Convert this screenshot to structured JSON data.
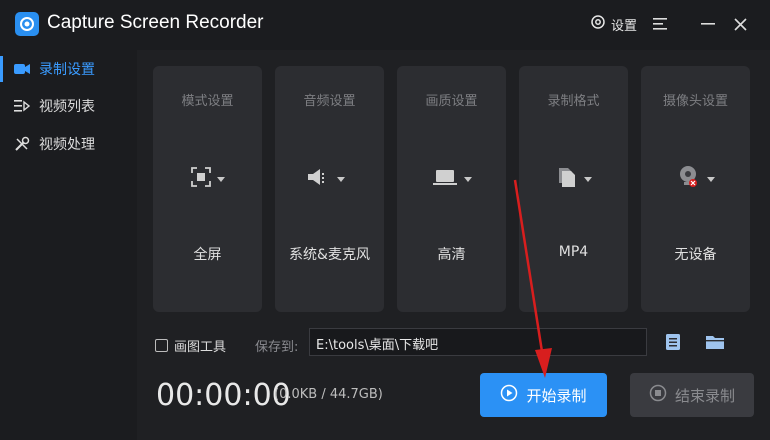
{
  "app": {
    "title": "Capture Screen Recorder"
  },
  "titlebar": {
    "settings_label": "设置"
  },
  "sidebar": {
    "items": [
      {
        "label": "录制设置",
        "icon": "camera-icon"
      },
      {
        "label": "视频列表",
        "icon": "list-play-icon"
      },
      {
        "label": "视频处理",
        "icon": "tools-icon"
      }
    ]
  },
  "cards": [
    {
      "title": "模式设置",
      "value": "全屏",
      "icon": "fullscreen-icon"
    },
    {
      "title": "音频设置",
      "value": "系统&麦克风",
      "icon": "speaker-icon"
    },
    {
      "title": "画质设置",
      "value": "高清",
      "icon": "laptop-icon"
    },
    {
      "title": "录制格式",
      "value": "MP4",
      "icon": "file-icon"
    },
    {
      "title": "摄像头设置",
      "value": "无设备",
      "icon": "webcam-icon"
    }
  ],
  "options": {
    "draw_tool_label": "画图工具",
    "draw_tool_checked": false,
    "save_to_label": "保存到:",
    "save_path": "E:\\tools\\桌面\\下载吧"
  },
  "status": {
    "timer": "00:00:00",
    "size": "(0.0KB / 44.7GB)"
  },
  "actions": {
    "start_label": "开始录制",
    "stop_label": "结束录制"
  },
  "colors": {
    "accent": "#2b91f5",
    "background": "#1f2023",
    "card": "#2c2d31",
    "annotation_arrow": "#d81e1e"
  }
}
